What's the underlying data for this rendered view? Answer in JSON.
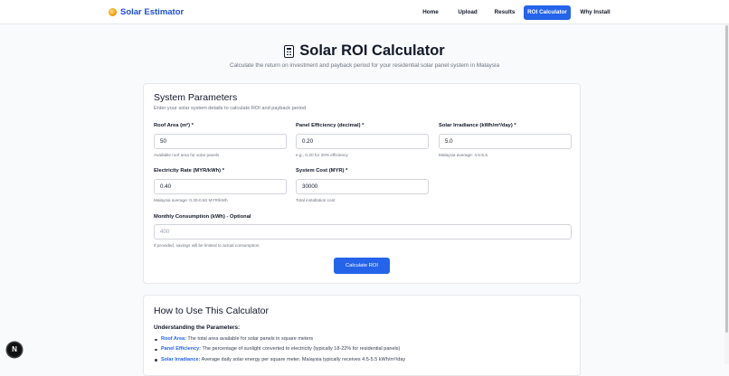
{
  "navbar": {
    "brand": "Solar Estimator",
    "links": [
      {
        "label": "Home",
        "active": false
      },
      {
        "label": "Upload",
        "active": false
      },
      {
        "label": "Results",
        "active": false
      },
      {
        "label": "ROI Calculator",
        "active": true
      },
      {
        "label": "Why Install",
        "active": false
      }
    ]
  },
  "page": {
    "title": "Solar ROI Calculator",
    "subtitle": "Calculate the return on investment and payback period for your residential solar panel system in Malaysia"
  },
  "params": {
    "title": "System Parameters",
    "description": "Enter your solar system details to calculate ROI and payback period",
    "fields": [
      {
        "label": "Roof Area (m²) *",
        "value": "50",
        "placeholder": "",
        "hint": "Available roof area for solar panels"
      },
      {
        "label": "Panel Efficiency (decimal) *",
        "value": "0.20",
        "placeholder": "",
        "hint": "e.g., 0.20 for 20% efficiency"
      },
      {
        "label": "Solar Irradiance (kWh/m²/day) *",
        "value": "5.0",
        "placeholder": "",
        "hint": "Malaysia average: 4.5-5.5"
      },
      {
        "label": "Electricity Rate (MYR/kWh) *",
        "value": "0.40",
        "placeholder": "",
        "hint": "Malaysia average: 0.30-0.50 MYR/kWh"
      },
      {
        "label": "System Cost (MYR) *",
        "value": "30000",
        "placeholder": "",
        "hint": "Total installation cost"
      },
      {
        "label": "Monthly Consumption (kWh) - Optional",
        "value": "",
        "placeholder": "400",
        "hint": "If provided, savings will be limited to actual consumption"
      }
    ],
    "button": "Calculate ROI"
  },
  "howto": {
    "title": "How to Use This Calculator",
    "subheading": "Understanding the Parameters:",
    "items": [
      {
        "term": "Roof Area:",
        "text": " The total area available for solar panels in square meters"
      },
      {
        "term": "Panel Efficiency:",
        "text": " The percentage of sunlight converted to electricity (typically 18-22% for residential panels)"
      },
      {
        "term": "Solar Irradiance:",
        "text": " Average daily solar energy per square meter. Malaysia typically receives 4.5-5.5 kWh/m²/day"
      }
    ]
  },
  "badge": "N",
  "colors": {
    "accent": "#2563eb",
    "brand": "#1d4ed8",
    "highlight_term": "#2563eb"
  },
  "icons": {
    "brand": "sun-icon",
    "title": "calculator-icon"
  }
}
